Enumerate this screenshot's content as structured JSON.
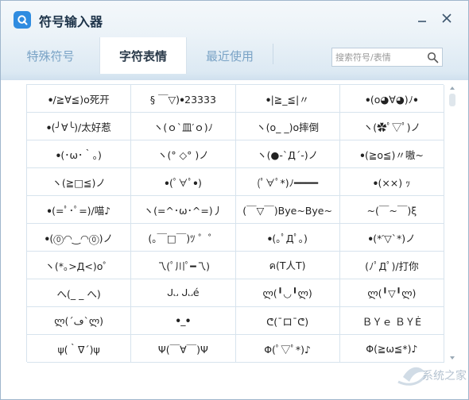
{
  "app": {
    "title": "符号输入器"
  },
  "tabs": [
    {
      "label": "特殊符号",
      "active": false
    },
    {
      "label": "字符表情",
      "active": true
    },
    {
      "label": "最近使用",
      "active": false
    }
  ],
  "search": {
    "placeholder": "搜索符号/表情"
  },
  "emoticons": [
    "ꔷ/≧∀≦)o死开",
    "§ ￣▽)ꔷ23333",
    "ꔷ|≧_≦|〃",
    "ꔷ(o◕∀◕)ﾉꔷ",
    "ꔷ(╯∀╰)/太好惹",
    "ヽ(ｏ`皿′ｏ)ﾉ",
    "ヽ(o_ _)o摔倒",
    "ヽ(✿ﾟ▽ﾟ)ノ",
    "ꔷ(･ω･｀｡)",
    "ヽ(° ◇° )ノ",
    "ヽ(●-`Д´-)ノ",
    "ꔷ(≧o≦)〃嗷~",
    "ヽ(≧□≦)ノ",
    "ꔷ(ﾟ∀ﾟꔷ)",
    "(ﾟ∀ﾟ*)ﾉ━━━━",
    "ꔷ(××) ｯ",
    "ꔷ(=ﾟ･ﾟ=)/喵♪",
    "ヽ(=^･ω･^=)丿",
    "(￣▽￣)Bye~Bye~",
    "~(￣~￣)ξ",
    "ꔷ(⓪◠‿◠⓪)ノ",
    "(｡￣□￣)ﾂ ゜゜",
    "ꔷ(｡ﾟДﾟ｡)",
    "ꔷ(*′▽`*)ノ",
    "ヽ(*｡>Д<)o゜",
    "乁(ﾟ川ﾟ━乁)",
    "ค(T人T)",
    "(ﾉﾟДﾟ)/打你",
    "へ(_ _ へ)",
    "ᒍ᎑ ᒍ᎑é",
    "ლ(╹◡╹ლ)",
    "ლ(╹▽╹ლ)",
    "ლ(´ڡ`ლ)",
    "ꔷ_ꔷ",
    "ᕦ(¯ロ¯ᕦ)",
    "ＢＹｅ ＢＹĖ",
    "ψ(｀∇´)ψ",
    "Ψ(￣∀￣)Ψ",
    "Φ(ﾟ▽ﾟ*)♪",
    "Φ(≧ω≦*)♪"
  ],
  "watermark": {
    "text": "系统之家"
  },
  "colors": {
    "accent": "#2f8ce0",
    "tab_inactive": "#7aa3c6",
    "grid_line": "#d7e3ed"
  }
}
